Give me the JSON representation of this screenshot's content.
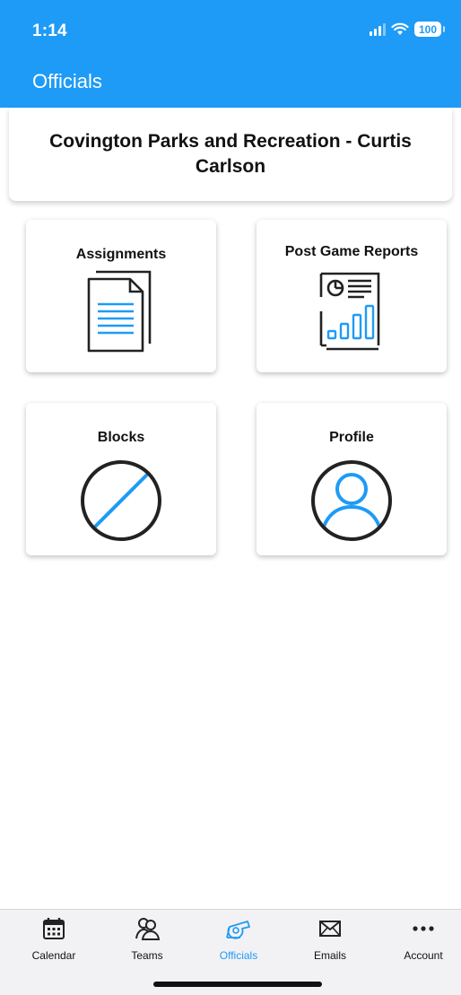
{
  "status_bar": {
    "time": "1:14",
    "battery": "100"
  },
  "header": {
    "title": "Officials",
    "bg_color": "#1e9bf6"
  },
  "org_card": {
    "title": "Covington Parks and Recreation - Curtis Carlson"
  },
  "tiles": [
    {
      "label": "Assignments",
      "icon": "document-icon"
    },
    {
      "label": "Post Game Reports",
      "icon": "report-chart-icon"
    },
    {
      "label": "Blocks",
      "icon": "blocked-icon"
    },
    {
      "label": "Profile",
      "icon": "profile-icon"
    }
  ],
  "tabbar": {
    "items": [
      {
        "label": "Calendar",
        "icon": "calendar-icon",
        "active": false
      },
      {
        "label": "Teams",
        "icon": "teams-icon",
        "active": false
      },
      {
        "label": "Officials",
        "icon": "whistle-icon",
        "active": true
      },
      {
        "label": "Emails",
        "icon": "envelope-icon",
        "active": false
      },
      {
        "label": "Account",
        "icon": "more-dots-icon",
        "active": false
      }
    ]
  },
  "colors": {
    "accent": "#1e9bf6",
    "icon_dark": "#222222"
  }
}
